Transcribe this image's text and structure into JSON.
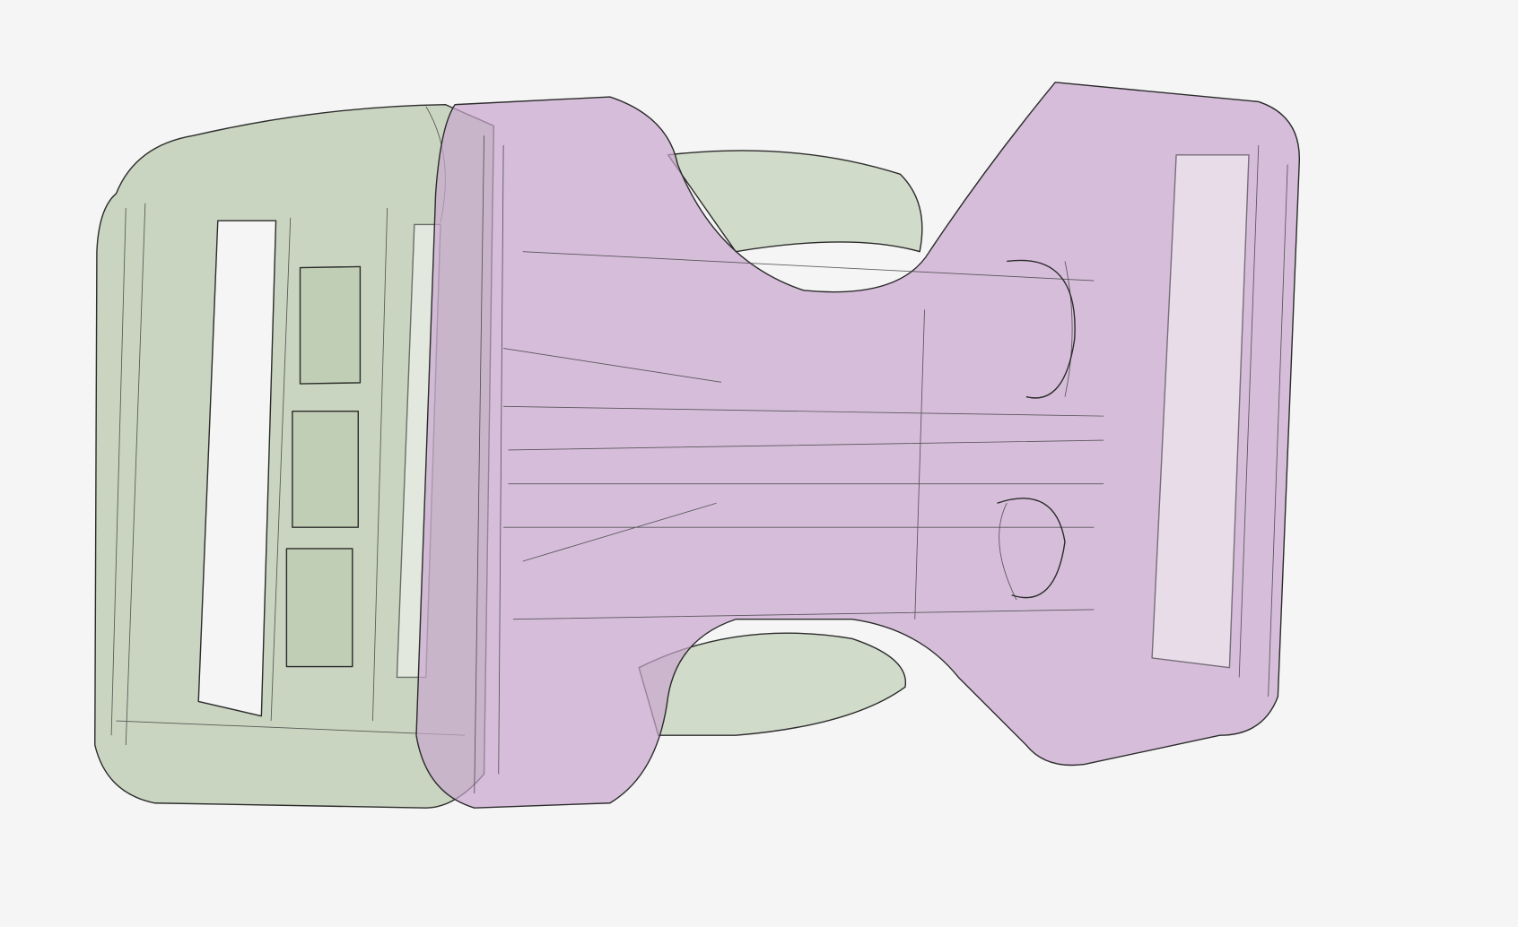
{
  "viewport": {
    "background": "#f5f5f5",
    "edge_color": "#2b2b2b",
    "parts": [
      {
        "name": "male-buckle-part",
        "color": "#b9c9ae",
        "opacity": 0.75
      },
      {
        "name": "female-buckle-housing",
        "color": "#c9a6cf",
        "opacity": 0.7
      }
    ]
  }
}
